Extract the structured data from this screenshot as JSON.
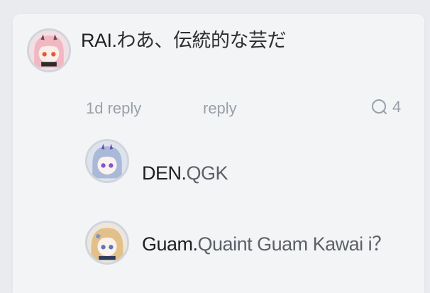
{
  "comment": {
    "author": "RAI.",
    "text": "わあ、伝統的な芸だ",
    "time": "1d reply",
    "reply_label": "reply",
    "reply_count": "4"
  },
  "replies": [
    {
      "author": "DEN.",
      "text": "QGK"
    },
    {
      "author": "Guam.",
      "text": "Quaint Guam Kawai i？"
    }
  ],
  "colors": {
    "background": "#e9ebef",
    "card": "#f3f4f6",
    "author_text": "#1f1f1f",
    "message_text": "#5c6068",
    "meta_text": "#9aa0a8"
  },
  "icons": {
    "reply_count": "speech-bubble-icon"
  }
}
